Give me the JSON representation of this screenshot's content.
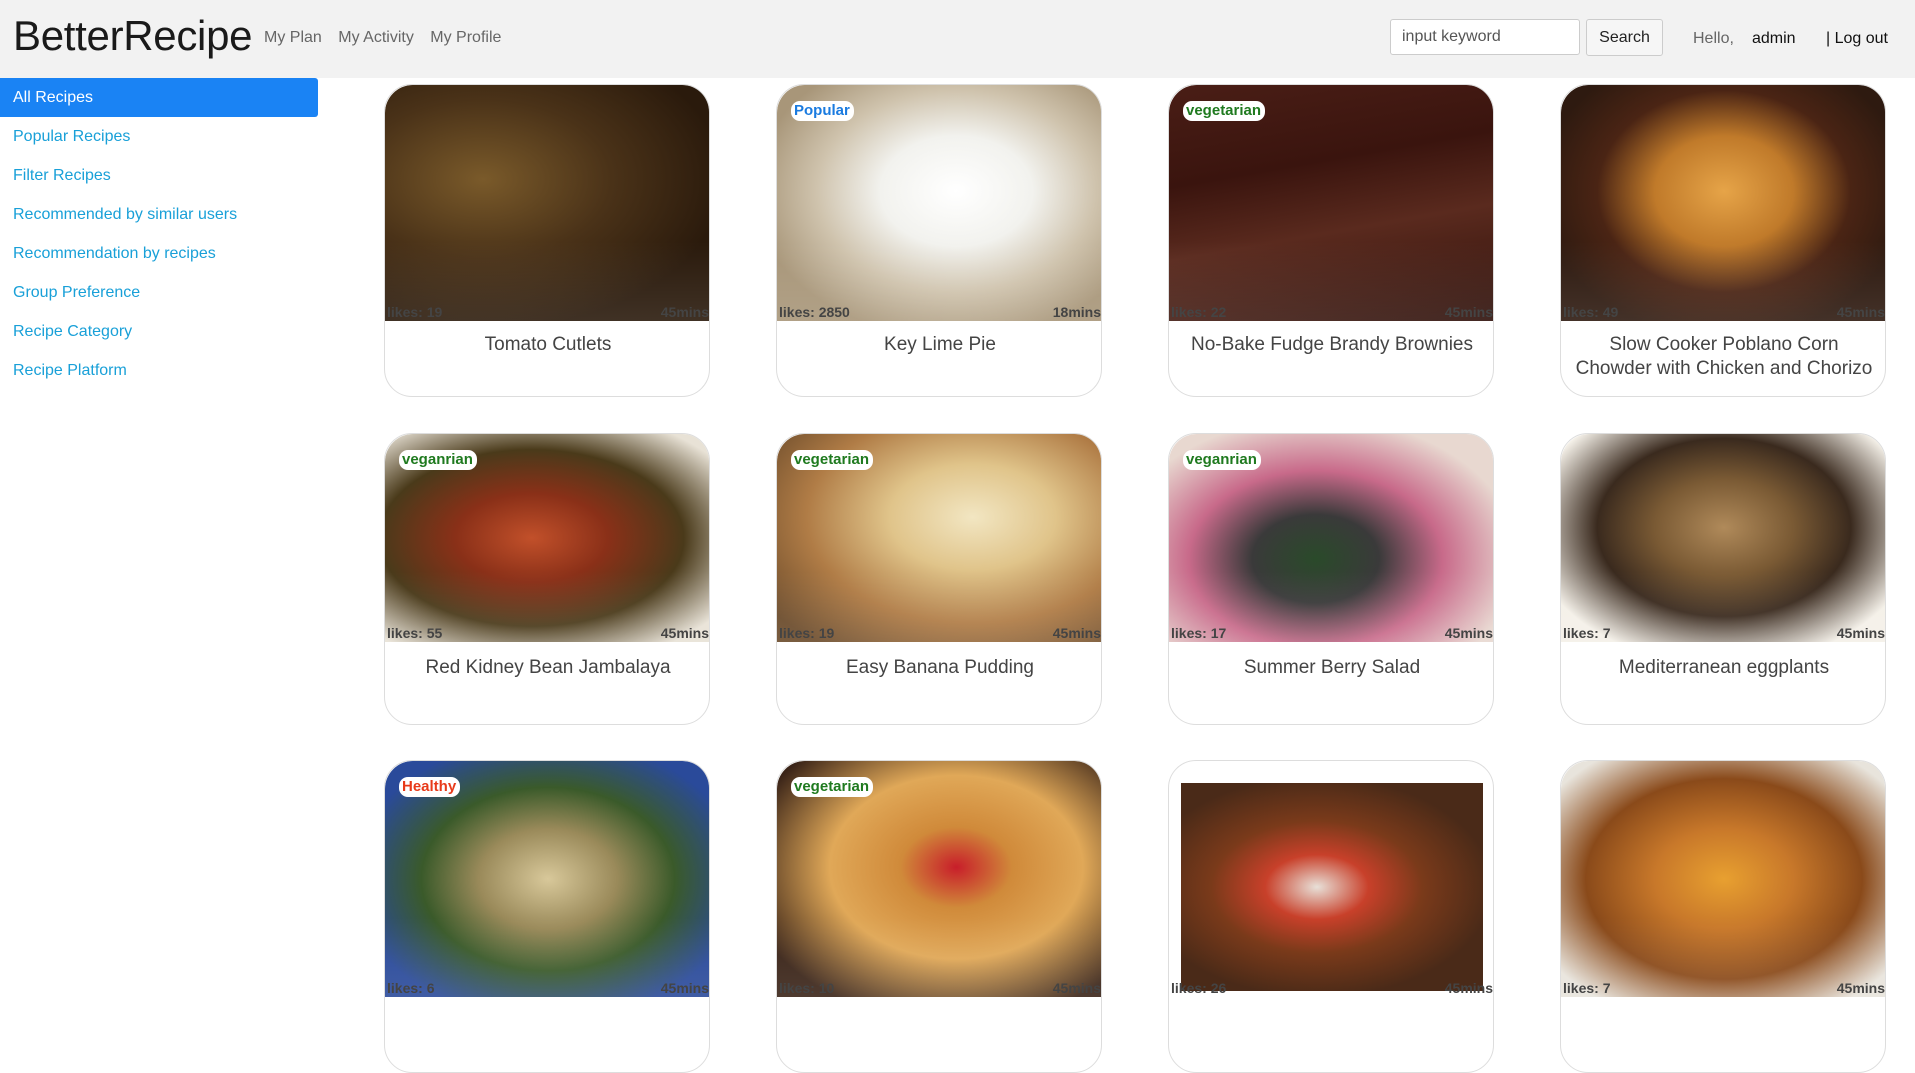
{
  "header": {
    "brand": "BetterRecipe",
    "nav": [
      "My Plan",
      "My Activity",
      "My Profile"
    ],
    "search_placeholder": "input keyword",
    "search_button": "Search",
    "greeting": "Hello,",
    "username": "admin",
    "logout": "| Log out"
  },
  "sidebar": {
    "items": [
      {
        "label": "All Recipes",
        "active": true
      },
      {
        "label": "Popular Recipes"
      },
      {
        "label": "Filter Recipes"
      },
      {
        "label": "Recommended by similar users"
      },
      {
        "label": "Recommendation by recipes"
      },
      {
        "label": "Group Preference"
      },
      {
        "label": "Recipe Category"
      },
      {
        "label": "Recipe Platform"
      }
    ]
  },
  "recipes": [
    {
      "title": "Tomato Cutlets",
      "likes": "likes: 19",
      "time": "45mins",
      "tag": "",
      "photo": "fried cutlets with herbs and grilled eggplant"
    },
    {
      "title": "Key Lime Pie",
      "likes": "likes: 2850",
      "time": "18mins",
      "tag": "Popular",
      "photo": "pie with whipped cream topping and limes"
    },
    {
      "title": "No-Bake Fudge Brandy Brownies",
      "likes": "likes: 22",
      "time": "45mins",
      "tag": "vegetarian",
      "photo": "stacked chocolate brownie slabs"
    },
    {
      "title": "Slow Cooker Poblano Corn Chowder with Chicken and Chorizo",
      "likes": "likes: 49",
      "time": "45mins",
      "tag": "",
      "photo": "chowder in a brown crock"
    },
    {
      "title": "Red Kidney Bean Jambalaya",
      "likes": "likes: 55",
      "time": "45mins",
      "tag": "veganrian",
      "photo": "bowl of bean jambalaya"
    },
    {
      "title": "Easy Banana Pudding",
      "likes": "likes: 19",
      "time": "45mins",
      "tag": "vegetarian",
      "photo": "banana pudding with wafers"
    },
    {
      "title": "Summer Berry Salad",
      "likes": "likes: 17",
      "time": "45mins",
      "tag": "veganrian",
      "photo": "berry and cucumber salad bowl"
    },
    {
      "title": "Mediterranean eggplants",
      "likes": "likes: 7",
      "time": "45mins",
      "tag": "",
      "photo": "stuffed baked eggplants"
    },
    {
      "title": "",
      "likes": "likes: 6",
      "time": "45mins",
      "tag": "Healthy",
      "photo": "pasta with greens and cheese"
    },
    {
      "title": "",
      "likes": "likes: 10",
      "time": "45mins",
      "tag": "vegetarian",
      "photo": "waffles with strawberries"
    },
    {
      "title": "",
      "likes": "likes: 26",
      "time": "45mins",
      "tag": "",
      "photo": "sliders with tomato"
    },
    {
      "title": "",
      "likes": "likes: 7",
      "time": "45mins",
      "tag": "",
      "photo": "grilled chicken with cilantro"
    }
  ]
}
